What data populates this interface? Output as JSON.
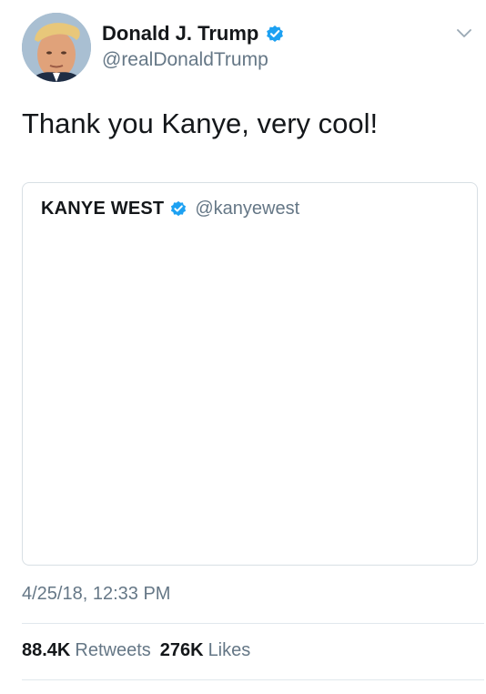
{
  "author": {
    "display_name": "Donald J. Trump",
    "handle": "@realDonaldTrump",
    "verified": true,
    "avatar": "profile-photo"
  },
  "tweet": {
    "text": "Thank you Kanye, very cool!",
    "timestamp": "4/25/18, 12:33 PM"
  },
  "quoted_tweet": {
    "display_name": "KANYE WEST",
    "handle": "@kanyewest",
    "verified": true
  },
  "stats": {
    "retweets_count": "88.4K",
    "retweets_label": "Retweets",
    "likes_count": "276K",
    "likes_label": "Likes"
  },
  "icons": {
    "verified": "verified-badge-icon",
    "menu": "chevron-down-icon"
  },
  "colors": {
    "verified_blue": "#1da1f2",
    "secondary_text": "#657786",
    "primary_text": "#14171a",
    "border": "#e1e8ed"
  }
}
